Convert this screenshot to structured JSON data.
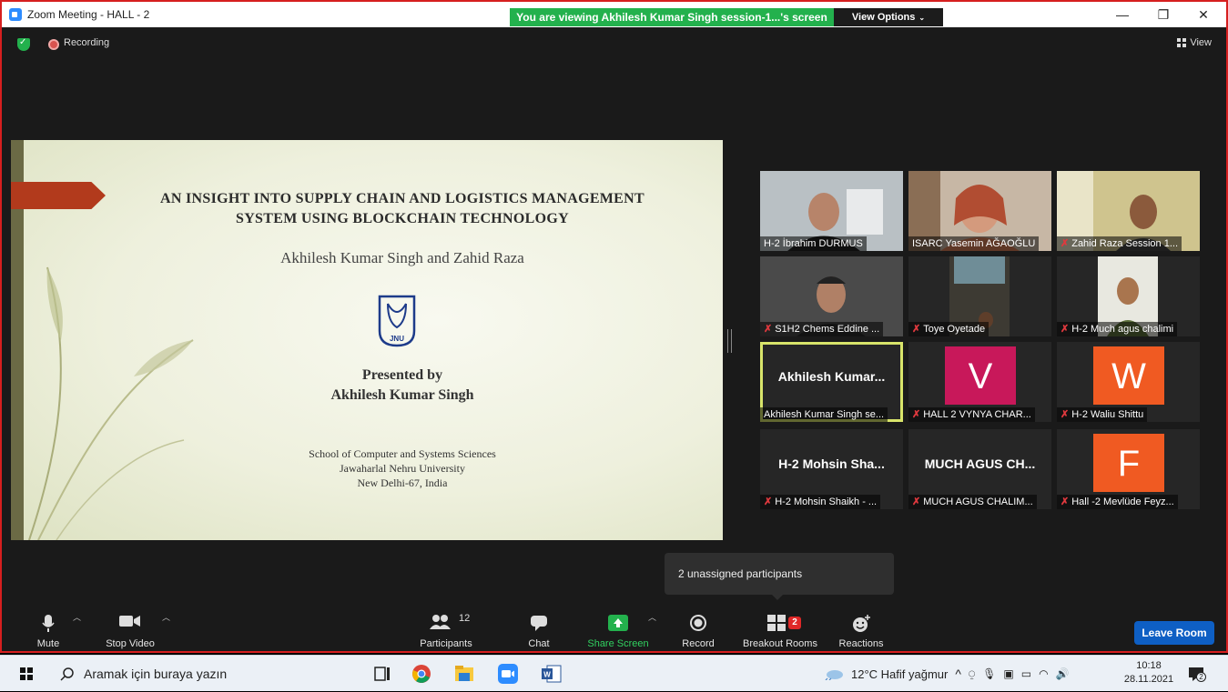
{
  "window": {
    "title": "Zoom Meeting - HALL - 2",
    "viewing_banner": "You are viewing Akhilesh Kumar Singh session-1...'s screen",
    "view_options": "View Options",
    "controls": {
      "minimize": "—",
      "restore": "❐",
      "close": "✕"
    }
  },
  "topbar": {
    "recording_label": "Recording",
    "view_label": "View"
  },
  "slide": {
    "title_line1": "AN INSIGHT INTO SUPPLY CHAIN AND LOGISTICS MANAGEMENT",
    "title_line2": "SYSTEM USING BLOCKCHAIN TECHNOLOGY",
    "authors": "Akhilesh Kumar Singh and Zahid Raza",
    "logo_text": "JNU",
    "presented_by": "Presented by",
    "presenter": "Akhilesh Kumar Singh",
    "school": "School of Computer and Systems Sciences",
    "university": "Jawaharlal Nehru University",
    "city": "New Delhi-67, India"
  },
  "gallery": {
    "tiles": [
      {
        "name": "H-2 İbrahim DURMUS",
        "muted": false
      },
      {
        "name": "ISARC Yasemin AĞAOĞLU",
        "muted": false
      },
      {
        "name": "Zahid Raza Session 1...",
        "muted": true
      },
      {
        "name": "S1H2 Chems Eddine ...",
        "muted": true
      },
      {
        "name": "Toye Oyetade",
        "muted": true
      },
      {
        "name": "H-2 Much agus chalimi",
        "muted": true
      },
      {
        "name": "Akhilesh Kumar Singh se...",
        "display": "Akhilesh  Kumar...",
        "muted": false
      },
      {
        "name": "HALL 2 VYNYA CHAR...",
        "avatar": "V",
        "avatar_color": "#c8185a",
        "muted": true
      },
      {
        "name": "H-2 Waliu Shittu",
        "avatar": "W",
        "avatar_color": "#f05a22",
        "muted": true
      },
      {
        "name": "H-2 Mohsin Shaikh - ...",
        "display": "H-2  Mohsin  Sha...",
        "muted": true
      },
      {
        "name": "MUCH AGUS CHALIM...",
        "display": "MUCH  AGUS  CH...",
        "muted": true
      },
      {
        "name": "Hall -2 Mevlüde Feyz...",
        "avatar": "F",
        "avatar_color": "#f05a22",
        "muted": true
      }
    ]
  },
  "tooltip": "2 unassigned participants",
  "toolbar": {
    "mute": "Mute",
    "stop_video": "Stop Video",
    "participants": "Participants",
    "participants_count": "12",
    "chat": "Chat",
    "share_screen": "Share Screen",
    "record": "Record",
    "breakout_rooms": "Breakout Rooms",
    "breakout_badge": "2",
    "reactions": "Reactions",
    "leave_room": "Leave Room"
  },
  "taskbar": {
    "search_placeholder": "Aramak için buraya yazın",
    "weather": "12°C  Hafif yağmur",
    "time": "10:18",
    "date": "28.11.2021",
    "notification_count": "2"
  },
  "colors": {
    "banner_green": "#23b14d",
    "leave_blue": "#0e5fc4",
    "active_speaker": "#d8e46a",
    "window_border": "#d61f1f"
  }
}
